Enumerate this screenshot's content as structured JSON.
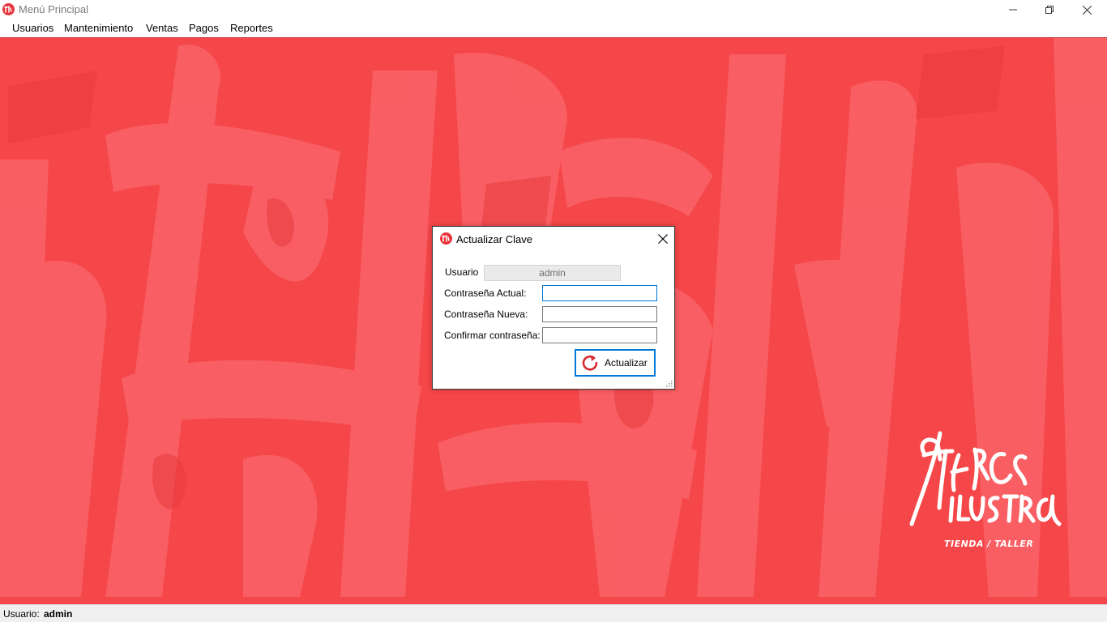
{
  "window": {
    "title": "Menú Principal",
    "minimize_icon": "minimize-icon",
    "maximize_icon": "restore-icon",
    "close_icon": "close-icon"
  },
  "menu": {
    "items": [
      {
        "label": "Usuarios"
      },
      {
        "label": "Mantenimiento"
      },
      {
        "label": "Ventas"
      },
      {
        "label": "Pagos"
      },
      {
        "label": "Reportes"
      }
    ]
  },
  "background": {
    "color": "#f54649"
  },
  "logo": {
    "subtitle": "TIENDA / TALLER"
  },
  "dialog": {
    "title": "Actualizar Clave",
    "user_label": "Usuario",
    "user_value": "admin",
    "current_password_label": "Contraseña Actual:",
    "current_password_value": "",
    "new_password_label": "Contraseña Nueva:",
    "new_password_value": "",
    "confirm_password_label": "Confirmar contraseña:",
    "confirm_password_value": "",
    "button_label": "Actualizar",
    "button_icon": "refresh-icon"
  },
  "statusbar": {
    "user_label": "Usuario:",
    "user_value": "admin"
  },
  "colors": {
    "accent": "#0078d7",
    "brand": "#e8323a"
  }
}
